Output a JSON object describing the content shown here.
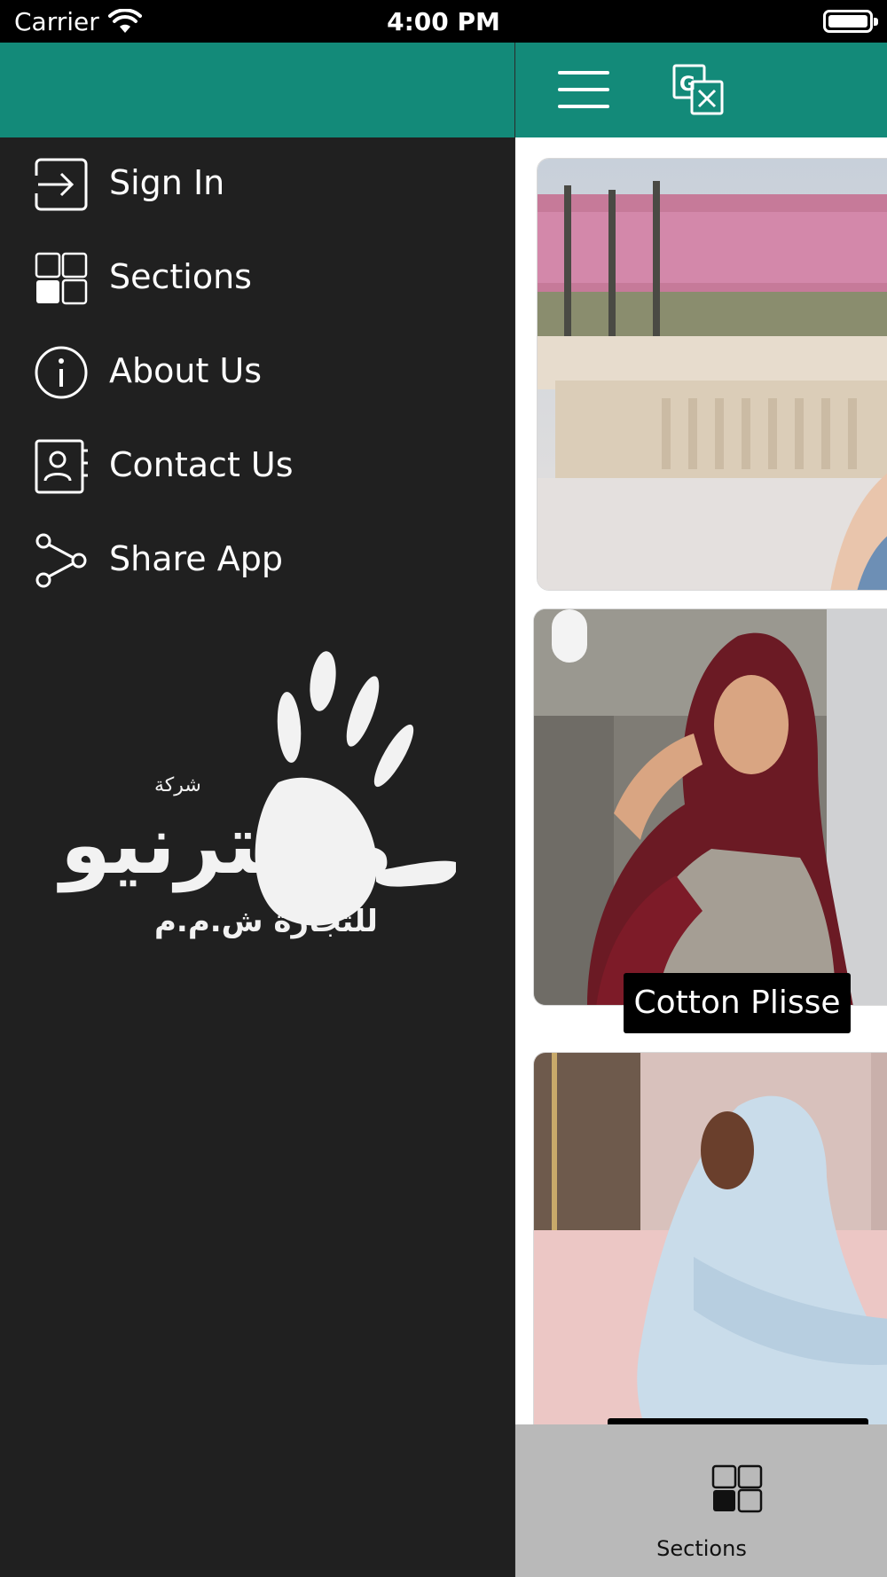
{
  "status_bar": {
    "carrier": "Carrier",
    "time": "4:00 PM"
  },
  "drawer": {
    "items": [
      {
        "label": "Sign In",
        "icon": "sign-in-icon"
      },
      {
        "label": "Sections",
        "icon": "grid-icon"
      },
      {
        "label": "About Us",
        "icon": "info-icon"
      },
      {
        "label": "Contact Us",
        "icon": "contact-book-icon"
      },
      {
        "label": "Share App",
        "icon": "share-icon"
      }
    ],
    "logo": {
      "line1": "شركة",
      "line2": "مسترنيو",
      "line3": "للتجارة ش.م.م"
    }
  },
  "main": {
    "banner": {
      "pages": 3,
      "active_page": 1
    },
    "products": [
      {
        "title": "Cotton Plisse"
      },
      {
        "title": ""
      }
    ],
    "bottom_tab": {
      "label": "Sections",
      "icon": "grid-icon"
    }
  },
  "colors": {
    "brand": "#138a79",
    "drawer_bg": "#202020",
    "tabbar_bg": "#b9b9b9"
  }
}
